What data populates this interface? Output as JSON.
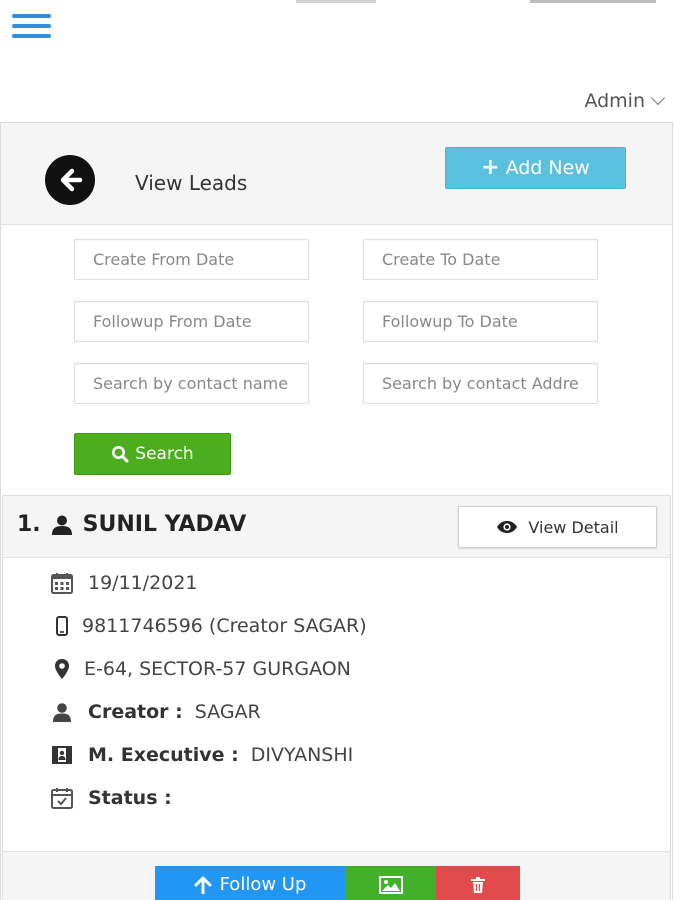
{
  "header": {
    "menu_icon": "hamburger-menu-icon",
    "user_label": "Admin",
    "accent_color": "#2f8fde"
  },
  "panel": {
    "title": "View Leads",
    "add_new_label": "Add New",
    "back_icon": "arrow-circle-left-icon"
  },
  "filters": {
    "create_from_placeholder": "Create From Date",
    "create_to_placeholder": "Create To Date",
    "followup_from_placeholder": "Followup From Date",
    "followup_to_placeholder": "Followup To Date",
    "search_name_placeholder": "Search by contact name",
    "search_address_placeholder": "Search by contact Address",
    "search_button_label": "Search"
  },
  "lead": {
    "index": "1.",
    "name": "SUNIL YADAV",
    "view_detail_label": "View Detail",
    "date": "19/11/2021",
    "phone": "9811746596 (Creator SAGAR)",
    "address": "E-64, SECTOR-57 GURGAON",
    "creator_label": "Creator :",
    "creator_value": "SAGAR",
    "executive_label": "M. Executive :",
    "executive_value": "DIVYANSHI",
    "status_label": "Status :",
    "status_value": ""
  },
  "actions": {
    "follow_up_label": "Follow Up",
    "follow_up_color": "#2196f3",
    "image_color": "#43b02a",
    "delete_color": "#e24b4b"
  }
}
